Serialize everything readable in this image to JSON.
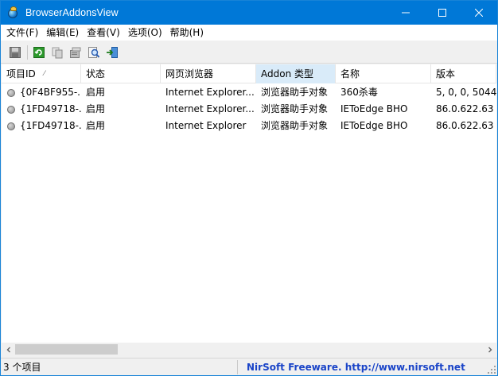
{
  "window": {
    "title": "BrowserAddonsView",
    "controls": [
      "minimize-icon",
      "maximize-icon",
      "close-icon"
    ]
  },
  "menu": {
    "items": [
      "文件(F)",
      "编辑(E)",
      "查看(V)",
      "选项(O)",
      "帮助(H)"
    ]
  },
  "toolbar": {
    "buttons": [
      "save-icon",
      "refresh-icon",
      "copy-icon",
      "properties-icon",
      "find-icon",
      "exit-icon"
    ]
  },
  "list": {
    "columns": [
      "项目ID",
      "状态",
      "网页浏览器",
      "Addon 类型",
      "名称",
      "版本"
    ],
    "sorted_column": "项目ID",
    "hovered_column": "Addon 类型",
    "rows": [
      [
        "{0F4BF955-...",
        "启用",
        "Internet Explorer...",
        "浏览器助手对象",
        "360杀毒",
        "5, 0, 0, 5044"
      ],
      [
        "{1FD49718-...",
        "启用",
        "Internet Explorer...",
        "浏览器助手对象",
        "IEToEdge BHO",
        "86.0.622.63"
      ],
      [
        "{1FD49718-...",
        "启用",
        "Internet Explorer",
        "浏览器助手对象",
        "IEToEdge BHO",
        "86.0.622.63"
      ]
    ]
  },
  "scrollbar": {
    "horizontal_thumb_fraction": 0.22
  },
  "status": {
    "count": "3 个项目",
    "link": "NirSoft Freeware.  http://www.nirsoft.net"
  },
  "colors": {
    "titlebar": "#0078d7",
    "link": "#1a44c8",
    "header_hover": "#d9ebf9"
  }
}
